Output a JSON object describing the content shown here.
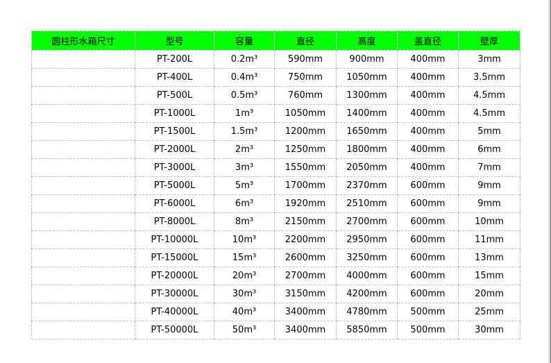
{
  "table": {
    "headers": [
      "圆柱形水箱尺寸",
      "型号",
      "容量",
      "直径",
      "高度",
      "盖直径",
      "壁厚"
    ],
    "header_color": "#00ff00",
    "rows": [
      [
        "",
        "PT-200L",
        "0.2m³",
        "590mm",
        "900mm",
        "400mm",
        "3mm"
      ],
      [
        "",
        "PT-400L",
        "0.4m³",
        "750mm",
        "1050mm",
        "400mm",
        "3.5mm"
      ],
      [
        "",
        "PT-500L",
        "0.5m³",
        "760mm",
        "1300mm",
        "400mm",
        "4.5mm"
      ],
      [
        "",
        "PT-1000L",
        "1m³",
        "1050mm",
        "1400mm",
        "400mm",
        "4.5mm"
      ],
      [
        "",
        "PT-1500L",
        "1.5m³",
        "1200mm",
        "1650mm",
        "400mm",
        "5mm"
      ],
      [
        "",
        "PT-2000L",
        "2m³",
        "1250mm",
        "1800mm",
        "400mm",
        "6mm"
      ],
      [
        "",
        "PT-3000L",
        "3m³",
        "1550mm",
        "2050mm",
        "400mm",
        "7mm"
      ],
      [
        "",
        "PT-5000L",
        "5m³",
        "1700mm",
        "2370mm",
        "600mm",
        "9mm"
      ],
      [
        "",
        "PT-6000L",
        "6m³",
        "1920mm",
        "2510mm",
        "600mm",
        "9mm"
      ],
      [
        "",
        "PT-8000L",
        "8m³",
        "2150mm",
        "2700mm",
        "600mm",
        "10mm"
      ],
      [
        "",
        "PT-10000L",
        "10m³",
        "2200mm",
        "2950mm",
        "600mm",
        "11mm"
      ],
      [
        "",
        "PT-15000L",
        "15m³",
        "2600mm",
        "3250mm",
        "600mm",
        "13mm"
      ],
      [
        "",
        "PT-20000L",
        "20m³",
        "2700mm",
        "4000mm",
        "600mm",
        "15mm"
      ],
      [
        "",
        "PT-30000L",
        "30m³",
        "3150mm",
        "4200mm",
        "600mm",
        "20mm"
      ],
      [
        "",
        "PT-40000L",
        "40m³",
        "3400mm",
        "4780mm",
        "500mm",
        "25mm"
      ],
      [
        "",
        "PT-50000L",
        "50m³",
        "3400mm",
        "5850mm",
        "500mm",
        "30mm"
      ]
    ]
  }
}
